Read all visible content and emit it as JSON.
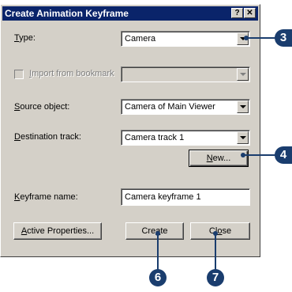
{
  "dialog": {
    "title": "Create Animation Keyframe",
    "help_button": "?",
    "close_button": "✕"
  },
  "type": {
    "label_u": "T",
    "label_rest": "ype:",
    "value": "Camera"
  },
  "import": {
    "label_u": "I",
    "label_rest": "mport from bookmark",
    "value": ""
  },
  "source": {
    "label_u": "S",
    "label_rest": "ource object:",
    "value": "Camera of Main Viewer"
  },
  "destination": {
    "label_u": "D",
    "label_rest": "estination track:",
    "value": "Camera track 1"
  },
  "new_button": {
    "label_u": "N",
    "label_rest": "ew..."
  },
  "keyframe": {
    "label_u": "K",
    "label_rest": "eyframe name:",
    "value": "Camera keyframe 1"
  },
  "buttons": {
    "active_u": "A",
    "active_rest": "ctive Properties...",
    "create_pre": "Cre",
    "create_u": "a",
    "create_post": "te",
    "close_pre": "Cl",
    "close_u": "o",
    "close_post": "se"
  },
  "callouts": {
    "c3": "3",
    "c4": "4",
    "c6": "6",
    "c7": "7"
  },
  "colors": {
    "titlebar": "#0a246a",
    "dialog": "#d4d0c8",
    "callout": "#1a3d6e"
  }
}
